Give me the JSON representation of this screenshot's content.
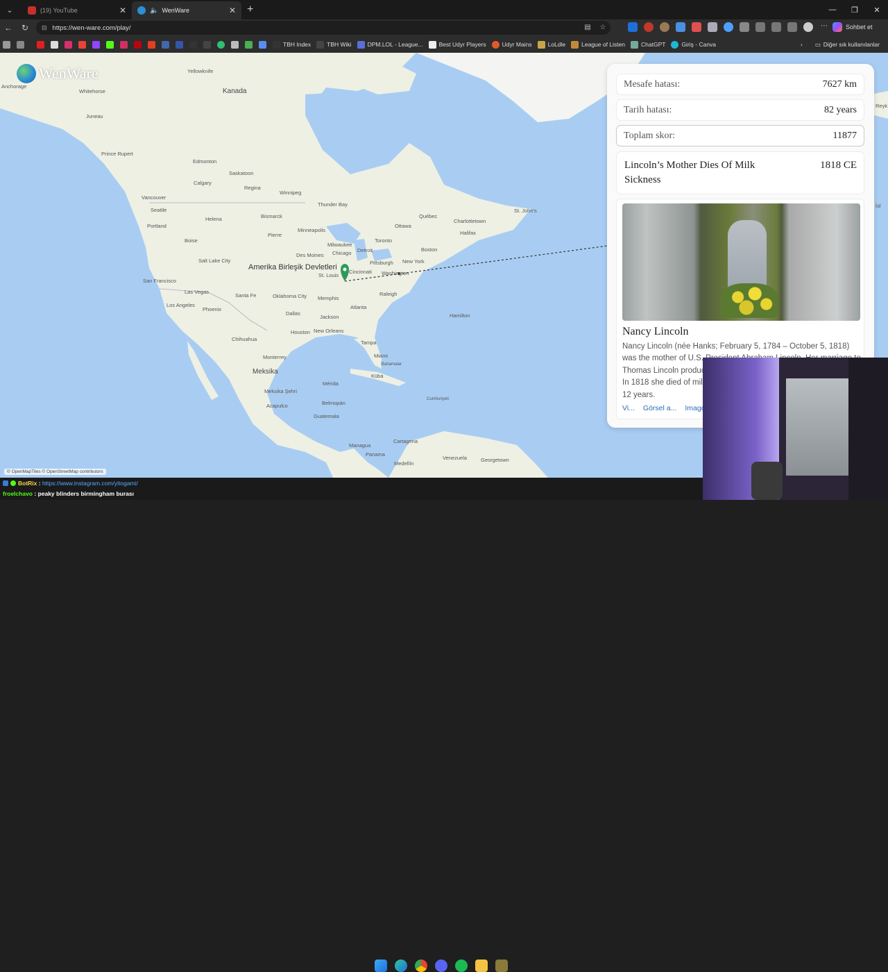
{
  "browser": {
    "tabs": [
      {
        "label": "(19) YouTube",
        "active": false
      },
      {
        "label": "WenWare",
        "active": true
      }
    ],
    "url": "https://wen-ware.com/play/",
    "copilot_label": "Sohbet et",
    "bookmarks": [
      {
        "label": "TBH Index"
      },
      {
        "label": "TBH Wiki"
      },
      {
        "label": "DPM.LOL - League..."
      },
      {
        "label": "Best Udyr Players"
      },
      {
        "label": "Udyr Mains"
      },
      {
        "label": "LoLdle"
      },
      {
        "label": "League of Listen"
      },
      {
        "label": "ChatGPT"
      },
      {
        "label": "Giriş - Canva"
      }
    ],
    "other_bookmarks": "Diğer sık kullanılanlar"
  },
  "app": {
    "name": "WenWare",
    "attribution": "© OpenMapTiles © OpenStreetMap contributors"
  },
  "map_labels": {
    "countries": {
      "canada": "Kanada",
      "usa": "Amerika Birleşik Devletleri",
      "mexico": "Meksika",
      "cuba": "Küba",
      "venezuela": "Venezuela"
    },
    "cities": {
      "anchorage": "Anchorage",
      "whitehorse": "Whitehorse",
      "yellowknife": "Yellowknife",
      "juneau": "Juneau",
      "prince_rupert": "Prince Rupert",
      "edmonton": "Edmonton",
      "saskatoon": "Saskatoon",
      "calgary": "Calgary",
      "regina": "Regina",
      "winnipeg": "Winnipeg",
      "vancouver": "Vancouver",
      "thunder_bay": "Thunder Bay",
      "seattle": "Seattle",
      "helena": "Helena",
      "bismarck": "Bismarck",
      "portland": "Portland",
      "pierre": "Pierre",
      "minneapolis": "Minneapolis",
      "boise": "Boise",
      "salt_lake_city": "Salt Lake City",
      "des_moines": "Des Moines",
      "milwaukee": "Milwaukee",
      "chicago": "Chicago",
      "detroit": "Detroit",
      "toronto": "Toronto",
      "ottawa": "Ottawa",
      "quebec": "Québec",
      "charlottetown": "Charlottetown",
      "halifax": "Halifax",
      "st_johns": "St. John's",
      "boston": "Boston",
      "new_york": "New York",
      "pittsburgh": "Pittsburgh",
      "cincinnati": "Cincinnati",
      "washington": "Washington",
      "st_louis": "St. Louis",
      "san_francisco": "San Francisco",
      "las_vegas": "Las Vegas",
      "santa_fe": "Santa Fe",
      "oklahoma_city": "Oklahoma City",
      "memphis": "Memphis",
      "raleigh": "Raleigh",
      "los_angeles": "Los Angeles",
      "phoenix": "Phoenix",
      "dallas": "Dallas",
      "jackson": "Jackson",
      "atlanta": "Atlanta",
      "hamilton": "Hamilton",
      "houston": "Houston",
      "new_orleans": "New Orleans",
      "chihuahua": "Chihuahua",
      "tampa": "Tampa",
      "miami": "Miami",
      "bahamalar": "Bahamalar",
      "monterrey": "Monterrey",
      "merida": "Mérida",
      "meksika_sehri": "Meksika Şehri",
      "acapulco": "Acapulco",
      "belmopan": "Belmopán",
      "cumhuriyeti": "Cumhuriyeti",
      "guatemala": "Guatemala",
      "managua": "Managua",
      "cartagena": "Cartagena",
      "panama": "Panama",
      "medellin": "Medellín",
      "georgetown": "Georgetown",
      "reykjavik_fragment": "Reyk",
      "isl_fragment": "İsl"
    }
  },
  "results": {
    "distance_label": "Mesafe hatası:",
    "distance_value": "7627 km",
    "date_label": "Tarih hatası:",
    "date_value": "82 years",
    "total_label": "Toplam skor:",
    "total_value": "11877",
    "event_title": "Lincoln’s Mother Dies Of Milk Sickness",
    "event_year": "1818 CE",
    "subject_name": "Nancy Lincoln",
    "subject_desc": "Nancy Lincoln (née Hanks; February 5, 1784 – October 5, 1818) was the mother of U.S. President Abraham Lincoln. Her marriage to Thomas Lincoln produced a daughter, Sarah, and son Thomas Jr. In 1818 she died of milk sickness, having been married for just over 12 years.",
    "links": [
      "Vi...",
      "Görsel a...",
      "Image"
    ]
  },
  "chat": [
    {
      "user": "BotRix",
      "message": "https://www.instagram.com/yitogami/"
    },
    {
      "user": "froelchavo",
      "message": "peaky blinders birmingham burası"
    }
  ],
  "colors": {
    "ocean": "#a9cdf2",
    "land": "#eef0e4",
    "marker": "#2e9a5a"
  }
}
